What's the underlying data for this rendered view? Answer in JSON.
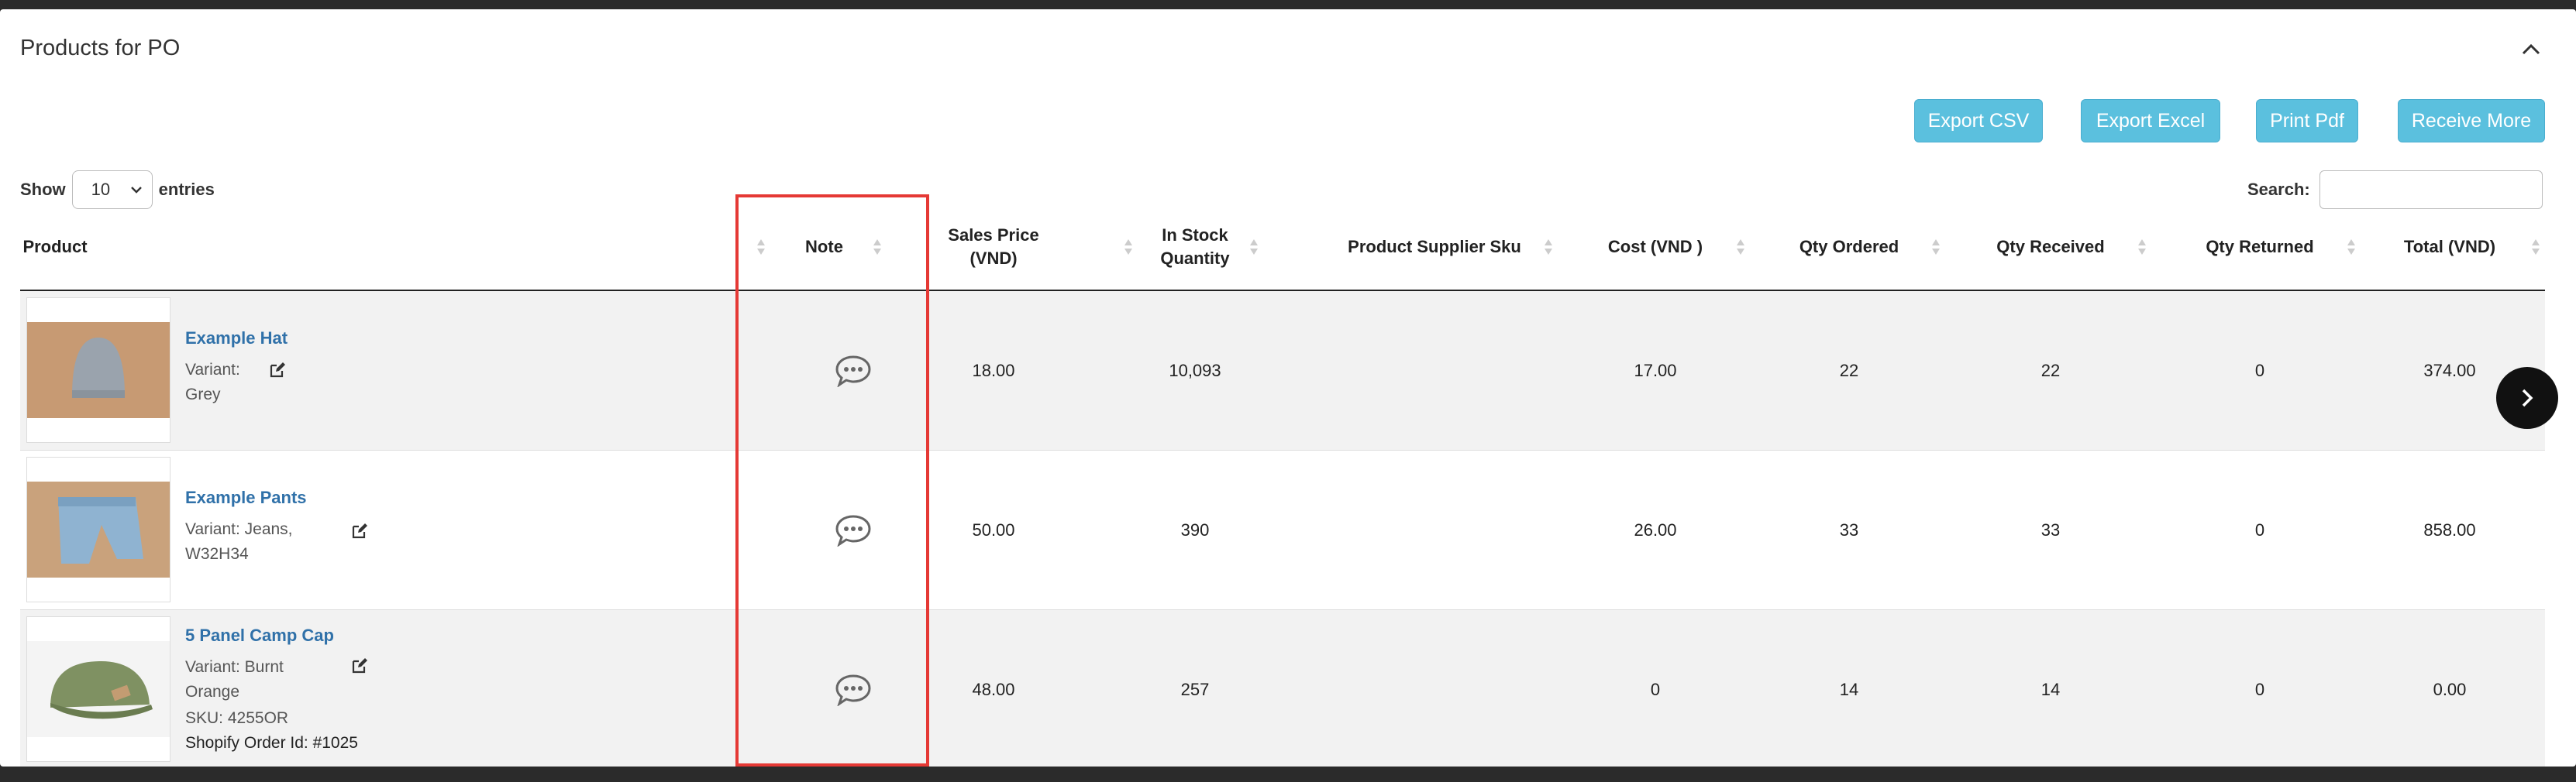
{
  "panel": {
    "title": "Products for PO"
  },
  "buttons": {
    "export_csv": "Export CSV",
    "export_excel": "Export Excel",
    "print_pdf": "Print Pdf",
    "receive_more": "Receive More"
  },
  "table_controls": {
    "show_label": "Show",
    "entries_value": "10",
    "entries_label": "entries",
    "search_label": "Search:",
    "search_value": ""
  },
  "columns": {
    "product": "Product",
    "note": "Note",
    "sales_price_1": "Sales Price",
    "sales_price_2": "(VND)",
    "in_stock_1": "In Stock",
    "in_stock_2": "Quantity",
    "supplier_sku": "Product Supplier Sku",
    "cost": "Cost (VND )",
    "qty_ordered": "Qty Ordered",
    "qty_received": "Qty Received",
    "qty_returned": "Qty Returned",
    "total": "Total (VND)"
  },
  "rows": [
    {
      "name": "Example Hat",
      "variant_1": "Variant:",
      "variant_2": "Grey",
      "sales_price": "18.00",
      "in_stock": "10,093",
      "supplier_sku": "",
      "cost": "17.00",
      "qty_ordered": "22",
      "qty_received": "22",
      "qty_returned": "0",
      "total": "374.00"
    },
    {
      "name": "Example Pants",
      "variant_1": "Variant: Jeans,",
      "variant_2": "W32H34",
      "sales_price": "50.00",
      "in_stock": "390",
      "supplier_sku": "",
      "cost": "26.00",
      "qty_ordered": "33",
      "qty_received": "33",
      "qty_returned": "0",
      "total": "858.00"
    },
    {
      "name": "5 Panel Camp Cap",
      "variant_1": "Variant: Burnt",
      "variant_2": "Orange",
      "sku": "SKU: 4255OR",
      "order": "Shopify Order Id: #1025",
      "sales_price": "48.00",
      "in_stock": "257",
      "supplier_sku": "",
      "cost": "0",
      "qty_ordered": "14",
      "qty_received": "14",
      "qty_returned": "0",
      "total": "0.00"
    }
  ],
  "colors": {
    "button_bg": "#5bc0de",
    "link": "#3071a9",
    "highlight": "#e53935"
  },
  "icons": [
    "chevron-up-icon",
    "chevron-down-icon",
    "sort-icon",
    "edit-icon",
    "chat-icon",
    "chevron-right-icon"
  ]
}
